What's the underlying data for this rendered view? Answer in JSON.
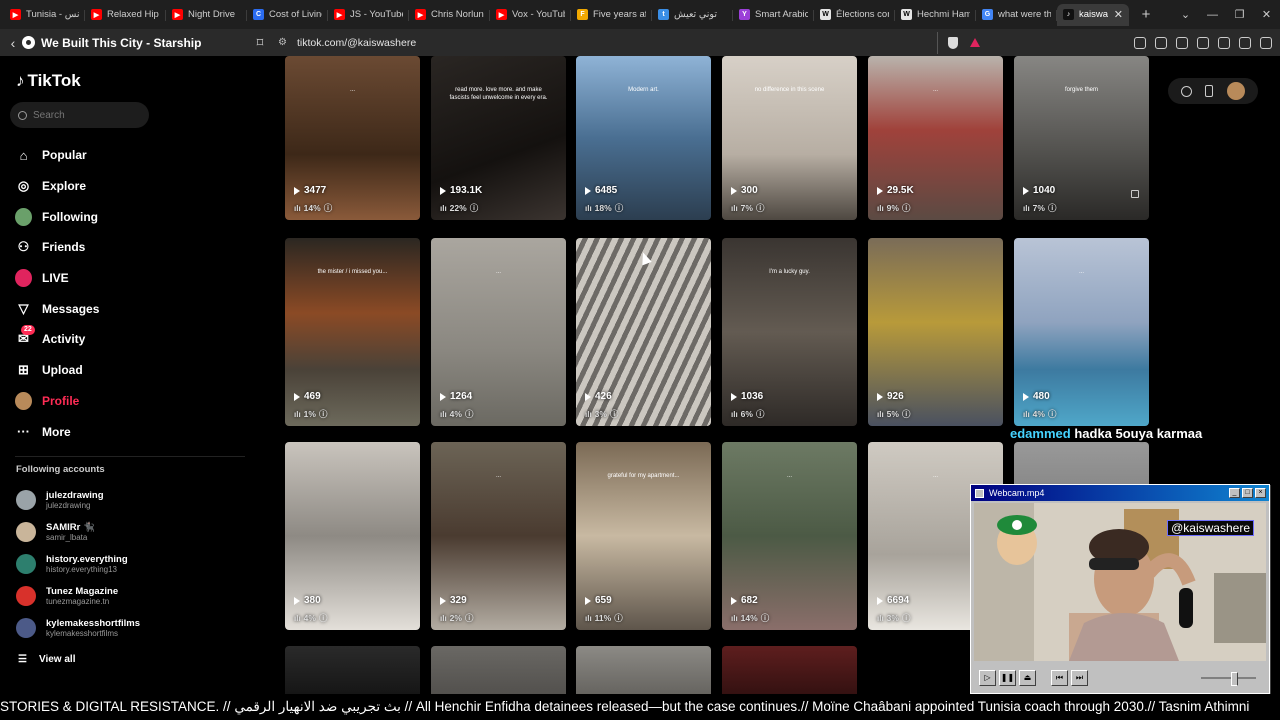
{
  "browser": {
    "tabs": [
      {
        "title": "Tunisia - تونس",
        "fav_color": "#ff0000",
        "fav": "▶"
      },
      {
        "title": "Relaxed Hip",
        "fav_color": "#ff0000",
        "fav": "▶"
      },
      {
        "title": "Night Drive",
        "fav_color": "#ff0000",
        "fav": "▶"
      },
      {
        "title": "Cost of Living",
        "fav_color": "#2b6cf0",
        "fav": "C"
      },
      {
        "title": "JS - YouTube",
        "fav_color": "#ff0000",
        "fav": "▶"
      },
      {
        "title": "Chris Norlun",
        "fav_color": "#ff0000",
        "fav": "▶"
      },
      {
        "title": "Vox - YouTub",
        "fav_color": "#ff0000",
        "fav": "▶"
      },
      {
        "title": "Five years aft",
        "fav_color": "#f2a900",
        "fav": "F"
      },
      {
        "title": "توني تعيش",
        "fav_color": "#3a8ee6",
        "fav": "t"
      },
      {
        "title": "Smart Arabic",
        "fav_color": "#9b3fd8",
        "fav": "Y"
      },
      {
        "title": "Élections con",
        "fav_color": "#e5e5e5",
        "fav": "W"
      },
      {
        "title": "Hechmi Ham",
        "fav_color": "#e5e5e5",
        "fav": "W"
      },
      {
        "title": "what were th",
        "fav_color": "#4285f4",
        "fav": "G"
      },
      {
        "title": "kaiswa",
        "fav_color": "#111111",
        "fav": "♪",
        "active": true
      }
    ],
    "now_playing": "We Built This City - Starship",
    "url": "tiktok.com/@kaiswashere"
  },
  "sidebar": {
    "logo": "TikTok",
    "search_placeholder": "Search",
    "nav": [
      {
        "label": "Popular",
        "icon": "home-icon"
      },
      {
        "label": "Explore",
        "icon": "compass-icon"
      },
      {
        "label": "Following",
        "icon": "following-avatar"
      },
      {
        "label": "Friends",
        "icon": "friends-icon"
      },
      {
        "label": "LIVE",
        "icon": "live-avatar"
      },
      {
        "label": "Messages",
        "icon": "messages-icon"
      },
      {
        "label": "Activity",
        "icon": "activity-icon",
        "badge": "22"
      },
      {
        "label": "Upload",
        "icon": "upload-icon"
      },
      {
        "label": "Profile",
        "icon": "profile-avatar"
      },
      {
        "label": "More",
        "icon": "more-icon"
      }
    ],
    "following_title": "Following accounts",
    "following": [
      {
        "name": "julezdrawing",
        "handle": "julezdrawing",
        "color": "#9aa3a8"
      },
      {
        "name": "SAMIRr 🐈‍⬛",
        "handle": "samir_lbata",
        "color": "#c9b59a"
      },
      {
        "name": "history.everything",
        "handle": "history.everything13",
        "color": "#2d7f6e"
      },
      {
        "name": "Tunez Magazine",
        "handle": "tunezmagazine.tn",
        "color": "#d8312b"
      },
      {
        "name": "kylemakesshortfilms",
        "handle": "kylemakesshortfilms",
        "color": "#4c5a88"
      }
    ],
    "view_all": "View all"
  },
  "videos": [
    {
      "views": "3477",
      "pct": "14%",
      "bg": "linear-gradient(180deg,#6b4a33,#3d2818 60%,#8a5a3a)",
      "cap": "..."
    },
    {
      "views": "193.1K",
      "pct": "22%",
      "bg": "linear-gradient(160deg,#2a2623,#14110f 60%,#3b3430)",
      "cap": "read more. love more. and make fascists feel unwelcome in every era."
    },
    {
      "views": "6485",
      "pct": "18%",
      "bg": "linear-gradient(180deg,#8fb3d6,#4a6f92 50%,#2c3e50)",
      "cap": "Modern art."
    },
    {
      "views": "300",
      "pct": "7%",
      "bg": "linear-gradient(180deg,#d7d0c7,#b7aea3 60%,#4e4841)",
      "cap": "no difference in this scene"
    },
    {
      "views": "29.5K",
      "pct": "9%",
      "bg": "linear-gradient(180deg,#b9b3ac,#a0423b 45%,#5b4a43)",
      "cap": "..."
    },
    {
      "views": "1040",
      "pct": "7%",
      "bg": "linear-gradient(180deg,#878683,#51504d 60%,#2a2927)",
      "cap": "forgive them",
      "lock": true
    },
    {
      "views": "469",
      "pct": "1%",
      "bg": "linear-gradient(180deg,#2b2722,#8b4a25 40%,#4a4238 70%,#6d6a5c)",
      "cap": "the mister / i missed you..."
    },
    {
      "views": "1264",
      "pct": "4%",
      "bg": "linear-gradient(180deg,#aaa69f,#8a8780 60%,#6b6962)",
      "cap": "..."
    },
    {
      "views": "426",
      "pct": "3%",
      "bg": "repeating-linear-gradient(115deg,#cbc7c0 0 6px,#6d6a66 6px 11px)",
      "cap": ""
    },
    {
      "views": "1036",
      "pct": "6%",
      "bg": "linear-gradient(180deg,#3a3531,#635b52 50%,#2e2a27)",
      "cap": "I'm a lucky guy."
    },
    {
      "views": "926",
      "pct": "5%",
      "bg": "linear-gradient(180deg,#7a6c58,#b89a3a 45%,#4a5160)",
      "cap": ""
    },
    {
      "views": "480",
      "pct": "4%",
      "bg": "linear-gradient(180deg,#b9c4d6,#8fa3bf 45%,#3d7aa0 70%,#4fa7c9)",
      "cap": "..."
    },
    {
      "views": "380",
      "pct": "4%",
      "bg": "linear-gradient(180deg,#c9c4bd,#8e8a84 50%,#e3dfd9)",
      "cap": ""
    },
    {
      "views": "329",
      "pct": "2%",
      "bg": "linear-gradient(180deg,#6c6456,#4a3b30 50%,#b3aca2)",
      "cap": "..."
    },
    {
      "views": "659",
      "pct": "11%",
      "bg": "linear-gradient(180deg,#7b6a55,#c8b9a2 50%,#5e554b)",
      "cap": "grateful for my apartment..."
    },
    {
      "views": "682",
      "pct": "14%",
      "bg": "linear-gradient(180deg,#6d7a64,#4c5a45 50%,#8a6e6a)",
      "cap": "..."
    },
    {
      "views": "6694",
      "pct": "3%",
      "bg": "linear-gradient(180deg,#cfcac2,#a8a39b 60%,#e9e6e0)",
      "cap": "..."
    },
    {
      "views": "",
      "pct": "",
      "bg": "linear-gradient(180deg,#999,#555)",
      "cap": ""
    },
    {
      "views": "",
      "pct": "",
      "bg": "linear-gradient(180deg,#2a2a2a,#111)",
      "cap": ""
    },
    {
      "views": "",
      "pct": "",
      "bg": "linear-gradient(180deg,#6a6864,#4d4b48)",
      "cap": ""
    },
    {
      "views": "",
      "pct": "",
      "bg": "linear-gradient(180deg,#8c8a85,#5d5b57)",
      "cap": ""
    },
    {
      "views": "",
      "pct": "",
      "bg": "linear-gradient(180deg,#5e1e1e,#2a0e0e)",
      "cap": ""
    }
  ],
  "overlay": {
    "user": "edammed",
    "message": "hadka 5ouya karmaa"
  },
  "webcam": {
    "title": "Webcam.mp4",
    "handle": "@kaiswashere"
  },
  "ticker": "STORIES & DIGITAL RESISTANCE. // بث تجريبي ضد الانهيار الرقمي // All Henchir Enfidha detainees released—but the case continues.// Moïne Chaâbani appointed Tunisia coach through 2030.// Tasnim Athimni"
}
